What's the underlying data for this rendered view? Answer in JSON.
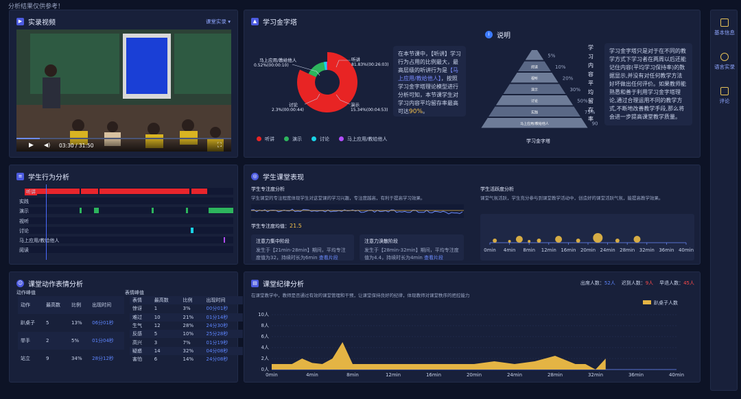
{
  "top_note": "分析结果仅供参考！",
  "video": {
    "title": "实录视频",
    "dropdown": "课堂实录",
    "time": "03:30 / 31:50"
  },
  "pyramid": {
    "title": "学习金字塔",
    "donut_labels": [
      {
        "name": "马上应用/教给他人",
        "pct": "0.52%(00:00:10)"
      },
      {
        "name": "听讲",
        "pct": "81.83%(00:26:03)"
      },
      {
        "name": "讨论",
        "pct": "2.3%(00:00:44)"
      },
      {
        "name": "演示",
        "pct": "15.34%(00:04:53)"
      }
    ],
    "legend": [
      {
        "name": "听讲",
        "color": "#e82424"
      },
      {
        "name": "演示",
        "color": "#2db55d"
      },
      {
        "name": "讨论",
        "color": "#19d3e6"
      },
      {
        "name": "马上应用/教给他人",
        "color": "#b24dff"
      }
    ],
    "desc_pre": "在本节课中，【听讲】学习行为占用的比例最大，最高层级的听讲行为是",
    "desc_hl": "【马上应用/教给他人】",
    "desc_post": "，按照学习金字塔理论模型进行分析可知，本节课学生对学习内容平均留存率最高可达",
    "desc_pct": "90%",
    "desc_end": "。",
    "explain_title": "说明",
    "pyramid_levels": [
      "",
      "阅读",
      "视听",
      "演示",
      "讨论",
      "实践",
      "马上应用/教给他人"
    ],
    "pyramid_pcts": [
      "5%",
      "10%",
      "20%",
      "30%",
      "50%",
      "75%",
      "90%"
    ],
    "pyramid_caption": "学习金字塔",
    "vertical_label": "学习内容平均留存率",
    "explain_text": "学习金字塔只是对于在不同的教学方式下学习者在两周以后还能记住内容(平均学习保持率)的数据显示,并没有对任何教学方法好坏做出任何评价。如果教师能熟悉和善于利用学习金字塔理论,通过合理运用不同的教学方式,不断地改善教学手段,那么将会进一步提高课堂教学质量。"
  },
  "right_nav": [
    {
      "label": "基本信息"
    },
    {
      "label": "语言实录"
    },
    {
      "label": "评论"
    }
  ],
  "behavior": {
    "title": "学生行为分析",
    "rows": [
      "听讲",
      "实践",
      "演示",
      "视听",
      "讨论",
      "马上应用/教给他人",
      "阅读"
    ]
  },
  "performance": {
    "title": "学生课堂表现",
    "focus_title": "学生专注度分析",
    "focus_desc": "学生课堂的专注程度体现学生对这堂课的学习兴趣，专注度越高，有利于提高学习效果。",
    "focus_avg_label": "学生专注度均值：",
    "focus_avg": "21.5",
    "card1_title": "注意力集中阶段",
    "card1_text": "发生于【21min-28min】期间，平均专注度值为32，持续时长为6min",
    "card1_link": "查看片段",
    "card2_title": "注意力涣散阶段",
    "card2_text": "发生于【28min-32min】期间，平均专注度值为4.4，持续时长为4min",
    "card2_link": "查看片段",
    "active_title": "学生活跃度分析",
    "active_desc": "课堂气氛活跃，学生充分参与到课堂教学活动中，创造好的课堂活跃气氛，能提高教学效果。",
    "axis": [
      "0min",
      "4min",
      "8min",
      "12min",
      "16min",
      "20min",
      "24min",
      "28min",
      "32min",
      "36min",
      "40min"
    ]
  },
  "emotion": {
    "title": "课堂动作表情分析",
    "action_label": "动作峰值",
    "face_label": "表情峰值",
    "action_head": [
      "动作",
      "最高数",
      "比例",
      "出现时间"
    ],
    "action_rows": [
      [
        "趴桌子",
        "5",
        "13%",
        "06分01秒"
      ],
      [
        "举手",
        "2",
        "5%",
        "01分04秒"
      ],
      [
        "站立",
        "9",
        "34%",
        "28分12秒"
      ]
    ],
    "face_head": [
      "表情",
      "最高数",
      "比例",
      "出现时间"
    ],
    "face_rows": [
      [
        "惊讶",
        "1",
        "3%",
        "00分01秒"
      ],
      [
        "难过",
        "10",
        "21%",
        "01分14秒"
      ],
      [
        "生气",
        "12",
        "28%",
        "24分30秒"
      ],
      [
        "反感",
        "5",
        "10%",
        "25分28秒"
      ],
      [
        "高兴",
        "3",
        "7%",
        "01分19秒"
      ],
      [
        "疑惑",
        "14",
        "32%",
        "04分08秒"
      ],
      [
        "害怕",
        "6",
        "14%",
        "24分08秒"
      ]
    ]
  },
  "discipline": {
    "title": "课堂纪律分析",
    "desc": "在课堂教学中，教师是否通过有效的课堂管理和干预，让课堂保持良好的纪律，体现教师对课堂秩序的把控能力",
    "attend_label": "出席人数：",
    "attend": "52人",
    "late_label": "迟到人数：",
    "late": "9人",
    "leave_label": "早退人数：",
    "leave": "45人",
    "legend": "趴桌子人数",
    "y_ticks": [
      "0人",
      "2人",
      "4人",
      "6人",
      "8人",
      "10人"
    ],
    "x_ticks": [
      "0min",
      "4min",
      "8min",
      "12min",
      "16min",
      "20min",
      "24min",
      "28min",
      "32min",
      "36min",
      "40min"
    ]
  },
  "chart_data": [
    {
      "type": "pie",
      "series": [
        {
          "name": "",
          "values": [
            81.83,
            15.34,
            2.3,
            0.52
          ]
        }
      ],
      "categories": [
        "听讲",
        "演示",
        "讨论",
        "马上应用/教给他人"
      ]
    },
    {
      "type": "area",
      "x": [
        0,
        1,
        2,
        3,
        4,
        5,
        6,
        7,
        8,
        9,
        10,
        11,
        12,
        14,
        16,
        18,
        20,
        22,
        24,
        26,
        28,
        30,
        31,
        32,
        33
      ],
      "series": [
        {
          "name": "趴桌子人数",
          "values": [
            1,
            1,
            1,
            2,
            1.2,
            1,
            2,
            5,
            1,
            1,
            1,
            1,
            1,
            1,
            1,
            1,
            1,
            1.5,
            1,
            1.5,
            2.5,
            1,
            1,
            0,
            2
          ]
        }
      ],
      "ylim": [
        0,
        10
      ],
      "xlabel": "",
      "ylabel": ""
    }
  ]
}
